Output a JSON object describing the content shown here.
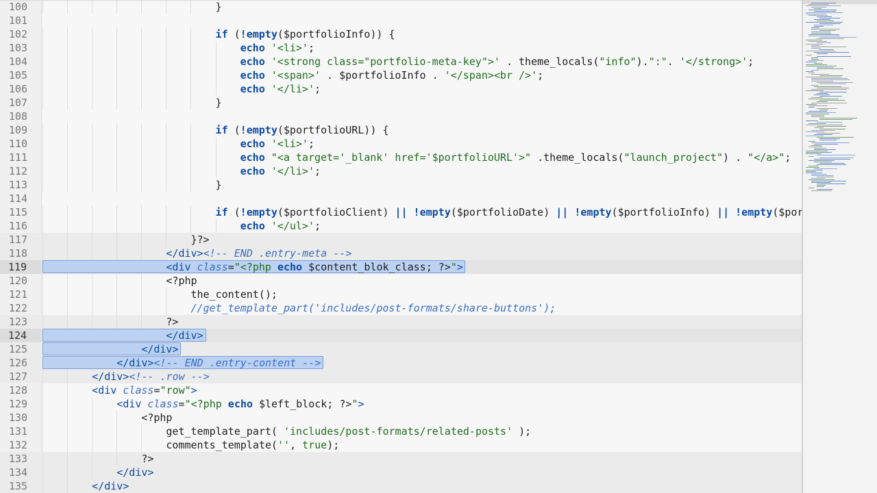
{
  "editor": {
    "lines": [
      {
        "num": "100",
        "indent": 7,
        "segs": [
          [
            "}",
            "v"
          ]
        ]
      },
      {
        "num": "101",
        "indent": 0,
        "segs": []
      },
      {
        "num": "102",
        "indent": 7,
        "segs": [
          [
            "if",
            "k"
          ],
          [
            " (",
            "v"
          ],
          [
            "!",
            "k"
          ],
          [
            "empty",
            "k"
          ],
          [
            "($portfolioInfo)) {",
            "v"
          ]
        ]
      },
      {
        "num": "103",
        "indent": 8,
        "segs": [
          [
            "echo",
            "k"
          ],
          [
            " ",
            "v"
          ],
          [
            "'<li>'",
            "s"
          ],
          [
            ";",
            "v"
          ]
        ]
      },
      {
        "num": "104",
        "indent": 8,
        "segs": [
          [
            "echo",
            "k"
          ],
          [
            " ",
            "v"
          ],
          [
            "'<strong class=\"portfolio-meta-key\">'",
            "s"
          ],
          [
            " . theme_locals(",
            "v"
          ],
          [
            "\"info\"",
            "s"
          ],
          [
            ").",
            "v"
          ],
          [
            "\":\"",
            "s"
          ],
          [
            ". ",
            "v"
          ],
          [
            "'</strong>'",
            "s"
          ],
          [
            ";",
            "v"
          ]
        ]
      },
      {
        "num": "105",
        "indent": 8,
        "segs": [
          [
            "echo",
            "k"
          ],
          [
            " ",
            "v"
          ],
          [
            "'<span>'",
            "s"
          ],
          [
            " . $portfolioInfo . ",
            "v"
          ],
          [
            "'</span><br />'",
            "s"
          ],
          [
            ";",
            "v"
          ]
        ]
      },
      {
        "num": "106",
        "indent": 8,
        "segs": [
          [
            "echo",
            "k"
          ],
          [
            " ",
            "v"
          ],
          [
            "'</li>'",
            "s"
          ],
          [
            ";",
            "v"
          ]
        ]
      },
      {
        "num": "107",
        "indent": 7,
        "segs": [
          [
            "}",
            "v"
          ]
        ]
      },
      {
        "num": "108",
        "indent": 0,
        "segs": []
      },
      {
        "num": "109",
        "indent": 7,
        "segs": [
          [
            "if",
            "k"
          ],
          [
            " (",
            "v"
          ],
          [
            "!",
            "k"
          ],
          [
            "empty",
            "k"
          ],
          [
            "($portfolioURL)) {",
            "v"
          ]
        ]
      },
      {
        "num": "110",
        "indent": 8,
        "segs": [
          [
            "echo",
            "k"
          ],
          [
            " ",
            "v"
          ],
          [
            "'<li>'",
            "s"
          ],
          [
            ";",
            "v"
          ]
        ]
      },
      {
        "num": "111",
        "indent": 8,
        "segs": [
          [
            "echo",
            "k"
          ],
          [
            " ",
            "v"
          ],
          [
            "\"<a target='_blank' href='$portfolioURL'>\"",
            "s"
          ],
          [
            " .theme_locals(",
            "v"
          ],
          [
            "\"launch_project\"",
            "s"
          ],
          [
            ") . ",
            "v"
          ],
          [
            "\"</a>\"",
            "s"
          ],
          [
            ";",
            "v"
          ]
        ]
      },
      {
        "num": "112",
        "indent": 8,
        "segs": [
          [
            "echo",
            "k"
          ],
          [
            " ",
            "v"
          ],
          [
            "'</li>'",
            "s"
          ],
          [
            ";",
            "v"
          ]
        ]
      },
      {
        "num": "113",
        "indent": 7,
        "segs": [
          [
            "}",
            "v"
          ]
        ]
      },
      {
        "num": "114",
        "indent": 0,
        "segs": []
      },
      {
        "num": "115",
        "indent": 7,
        "segs": [
          [
            "if",
            "k"
          ],
          [
            " (",
            "v"
          ],
          [
            "!",
            "k"
          ],
          [
            "empty",
            "k"
          ],
          [
            "($portfolioClient) ",
            "v"
          ],
          [
            "||",
            "k"
          ],
          [
            " ",
            "v"
          ],
          [
            "!",
            "k"
          ],
          [
            "empty",
            "k"
          ],
          [
            "($portfolioDate) ",
            "v"
          ],
          [
            "||",
            "k"
          ],
          [
            " ",
            "v"
          ],
          [
            "!",
            "k"
          ],
          [
            "empty",
            "k"
          ],
          [
            "($portfolioInfo) ",
            "v"
          ],
          [
            "||",
            "k"
          ],
          [
            " ",
            "v"
          ],
          [
            "!",
            "k"
          ],
          [
            "empty",
            "k"
          ],
          [
            "($portf",
            "v"
          ]
        ]
      },
      {
        "num": "116",
        "indent": 8,
        "segs": [
          [
            "echo",
            "k"
          ],
          [
            " ",
            "v"
          ],
          [
            "'</ul>'",
            "s"
          ],
          [
            ";",
            "v"
          ]
        ]
      },
      {
        "num": "117",
        "indent": 6,
        "segs": [
          [
            "}?>",
            "v"
          ]
        ]
      },
      {
        "num": "118",
        "indent": 5,
        "segs": [
          [
            "</div>",
            "t"
          ],
          [
            "<!-- END .entry-meta -->",
            "c"
          ]
        ]
      },
      {
        "num": "119",
        "indent": 5,
        "segs": [
          [
            "<div",
            "t"
          ],
          [
            " class",
            "a"
          ],
          [
            "=",
            "v"
          ],
          [
            "\"<?php ",
            "s"
          ],
          [
            "echo",
            "k"
          ],
          [
            " $content_blok_class; ?>",
            "v"
          ],
          [
            "\"",
            "s"
          ],
          [
            ">",
            "t"
          ]
        ]
      },
      {
        "num": "120",
        "indent": 5,
        "segs": [
          [
            "<?php",
            "v"
          ]
        ]
      },
      {
        "num": "121",
        "indent": 6,
        "segs": [
          [
            "the_content();",
            "v"
          ]
        ]
      },
      {
        "num": "122",
        "indent": 6,
        "segs": [
          [
            "//get_template_part('includes/post-formats/share-buttons');",
            "c"
          ]
        ]
      },
      {
        "num": "123",
        "indent": 5,
        "segs": [
          [
            "?>",
            "v"
          ]
        ]
      },
      {
        "num": "124",
        "indent": 5,
        "segs": [
          [
            "</div>",
            "t"
          ]
        ]
      },
      {
        "num": "125",
        "indent": 4,
        "segs": [
          [
            "</div>",
            "t"
          ]
        ]
      },
      {
        "num": "126",
        "indent": 3,
        "segs": [
          [
            "</div>",
            "t"
          ],
          [
            "<!-- END .entry-content -->",
            "c"
          ]
        ]
      },
      {
        "num": "127",
        "indent": 2,
        "segs": [
          [
            "</div>",
            "t"
          ],
          [
            "<!-- .row -->",
            "c"
          ]
        ]
      },
      {
        "num": "128",
        "indent": 2,
        "segs": [
          [
            "<div",
            "t"
          ],
          [
            " class",
            "a"
          ],
          [
            "=",
            "v"
          ],
          [
            "\"row\"",
            "s"
          ],
          [
            ">",
            "t"
          ]
        ]
      },
      {
        "num": "129",
        "indent": 3,
        "segs": [
          [
            "<div",
            "t"
          ],
          [
            " class",
            "a"
          ],
          [
            "=",
            "v"
          ],
          [
            "\"<?php ",
            "s"
          ],
          [
            "echo",
            "k"
          ],
          [
            " $left_block; ?>",
            "v"
          ],
          [
            "\"",
            "s"
          ],
          [
            ">",
            "t"
          ]
        ]
      },
      {
        "num": "130",
        "indent": 4,
        "segs": [
          [
            "<?php",
            "v"
          ]
        ]
      },
      {
        "num": "131",
        "indent": 5,
        "segs": [
          [
            "get_template_part( ",
            "v"
          ],
          [
            "'includes/post-formats/related-posts'",
            "s"
          ],
          [
            " );",
            "v"
          ]
        ]
      },
      {
        "num": "132",
        "indent": 5,
        "segs": [
          [
            "comments_template(",
            "v"
          ],
          [
            "''",
            "s"
          ],
          [
            ", ",
            "v"
          ],
          [
            "true",
            "n"
          ],
          [
            ");",
            "v"
          ]
        ]
      },
      {
        "num": "133",
        "indent": 4,
        "segs": [
          [
            "?>",
            "v"
          ]
        ]
      },
      {
        "num": "134",
        "indent": 3,
        "segs": [
          [
            "</div>",
            "t"
          ]
        ]
      },
      {
        "num": "135",
        "indent": 2,
        "segs": [
          [
            "</div>",
            "t"
          ]
        ]
      }
    ],
    "dim_lines": [
      "117",
      "118",
      "119",
      "123",
      "124",
      "125",
      "126",
      "127",
      "133",
      "134",
      "135"
    ],
    "current_lines": [
      "119",
      "124"
    ],
    "selected_lines": [
      "119",
      "124",
      "125",
      "126"
    ]
  },
  "colors": {
    "keyword": "#0a4aa3",
    "string": "#1f6d1f",
    "comment": "#3a6ec9",
    "selection": "#bcd2f2"
  }
}
